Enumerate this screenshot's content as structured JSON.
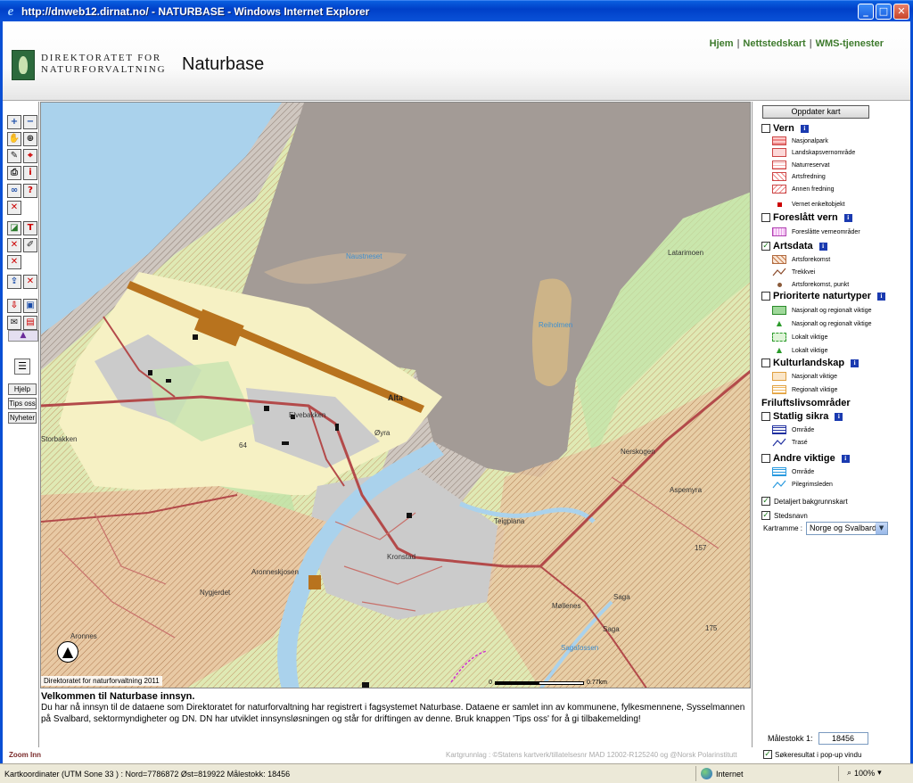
{
  "window": {
    "title": "http://dnweb12.dirnat.no/ - NATURBASE - Windows Internet Explorer",
    "min_label": "_",
    "max_label": "□",
    "close_label": "✕"
  },
  "header": {
    "org_line1": "DIREKTORATET FOR",
    "org_line2": "NATURFORVALTNING",
    "app_title": "Naturbase",
    "links": [
      "Hjem",
      "Nettstedskart",
      "WMS-tjenester"
    ],
    "separator": "|"
  },
  "toolbar": {
    "buttons": [
      {
        "icon": "zoom-in-icon",
        "glyph": "+",
        "tone": "blue"
      },
      {
        "icon": "zoom-out-icon",
        "glyph": "−",
        "tone": "blue"
      },
      {
        "icon": "pan-hand-icon",
        "glyph": "✋",
        "tone": ""
      },
      {
        "icon": "zoom-extent-icon",
        "glyph": "⊕",
        "tone": ""
      },
      {
        "icon": "measure-icon",
        "glyph": "✎",
        "tone": ""
      },
      {
        "icon": "identify-icon",
        "glyph": "⌖",
        "tone": "red"
      },
      {
        "icon": "print-icon",
        "glyph": "⎙",
        "tone": ""
      },
      {
        "icon": "info-icon",
        "glyph": "i",
        "tone": "red"
      },
      {
        "icon": "binoculars-icon",
        "glyph": "∞",
        "tone": "blue"
      },
      {
        "icon": "query-icon",
        "glyph": "?",
        "tone": "red"
      },
      {
        "icon": "clear-select-icon",
        "glyph": "✕",
        "tone": "red"
      },
      {
        "icon": "draw-polygon-icon",
        "glyph": "◪",
        "tone": "green"
      },
      {
        "icon": "select-text-icon",
        "glyph": "T",
        "tone": "red"
      },
      {
        "icon": "delete-icon",
        "glyph": "✕",
        "tone": "red"
      },
      {
        "icon": "edit-pen-icon",
        "glyph": "✐",
        "tone": ""
      },
      {
        "icon": "remove-icon",
        "glyph": "✕",
        "tone": "red"
      },
      {
        "icon": "export-icon",
        "glyph": "⇪",
        "tone": "blue"
      },
      {
        "icon": "remove-layer-icon",
        "glyph": "✕",
        "tone": "red"
      },
      {
        "icon": "import-icon",
        "glyph": "⇩",
        "tone": "red"
      },
      {
        "icon": "save-icon",
        "glyph": "▣",
        "tone": "blue"
      },
      {
        "icon": "mail-icon",
        "glyph": "✉",
        "tone": ""
      },
      {
        "icon": "screen-icon",
        "glyph": "▤",
        "tone": "red"
      }
    ],
    "collapse_glyph": "▲",
    "legend_glyph": "☰",
    "help_buttons": [
      "Hjelp",
      "Tips oss",
      "Nyheter"
    ]
  },
  "map": {
    "place_names": {
      "naustneset": "Naustneset",
      "reiholmen": "Reiholmen",
      "latarimoen": "Latarimoen",
      "alta": "Alta",
      "elvebakken": "Elvebakken",
      "oyra": "Øyra",
      "storbakken": "Storbakken",
      "nerskogen": "Nerskogen",
      "aspemyra": "Aspemyra",
      "teigplana": "Teigplana",
      "kronstad": "Kronstad",
      "aronneskjosen": "Aronneskjosen",
      "nygjerdet": "Nygjerdet",
      "mollenes": "Møllenes",
      "saga1": "Saga",
      "saga2": "Saga",
      "sagafossen": "Sagafossen",
      "aronnes": "Aronnes",
      "elev64": "64",
      "elev157": "157",
      "elev175": "175"
    },
    "copyright": "Direktoratet for naturforvaltning 2011",
    "scale_start": "0",
    "scale_end": "0.77km",
    "north_glyph": "▲"
  },
  "welcome": {
    "title": "Velkommen til Naturbase innsyn.",
    "body": "Du har nå innsyn til de dataene som Direktoratet for naturforvaltning har registrert i fagsystemet Naturbase. Dataene er samlet inn av kommunene, fylkesmennene, Sysselmannen på Svalbard, sektormyndigheter og DN. DN har utviklet innsynsløsningen og står for driftingen av denne. Bruk knappen 'Tips oss' for å gi tilbakemelding!"
  },
  "credits": "Kartgrunnlag : ©Statens kartverk/tillatelsesnr MAD 12002-R125240 og @Norsk Polarinstitutt",
  "zoom_mode": "Zoom Inn",
  "legend": {
    "update_button": "Oppdater kart",
    "info_glyph": "i",
    "check_glyph": "✓",
    "vern": {
      "label": "Vern",
      "items": [
        "Nasjonalpark",
        "Landskapsvernområde",
        "Naturreservat",
        "Artsfredning",
        "Annen fredning",
        "Vernet enkeltobjekt"
      ]
    },
    "foreslatt": {
      "label": "Foreslått vern",
      "items": [
        "Foreslåtte verneområder"
      ]
    },
    "artsdata": {
      "label": "Artsdata",
      "checked": true,
      "items": [
        "Artsforekomst",
        "Trekkvei",
        "Artsforekomst, punkt"
      ]
    },
    "prioriterte": {
      "label": "Prioriterte naturtyper",
      "items": [
        "Nasjonalt og regionalt viktige",
        "Nasjonalt og regionalt viktige",
        "Lokalt viktige",
        "Lokalt viktige"
      ]
    },
    "kulturlandskap": {
      "label": "Kulturlandskap",
      "items": [
        "Nasjonalt viktige",
        "Regionalt viktige"
      ]
    },
    "friluftsliv": {
      "label": "Friluftslivsområder"
    },
    "statlig": {
      "label": "Statlig sikra",
      "items": [
        "Område",
        "Trasé"
      ]
    },
    "andre": {
      "label": "Andre viktige",
      "items": [
        "Område",
        "Pilegrimsleden"
      ]
    },
    "detaljert": "Detaljert bakgrunnskart",
    "stedsnavn": "Stedsnavn",
    "kartramme_label": "Kartramme :",
    "kartramme_value": "Norge og Svalbard",
    "malestokk_label": "Målestokk 1:",
    "malestokk_value": "18456",
    "popup_label": "Søkeresultat i pop-up vindu"
  },
  "status": {
    "coords": "Kartkoordinater (UTM Sone 33 ) :   Nord=7786872  Øst=819922     Målestokk: 18456",
    "zone": "Internet",
    "zoom": "100%"
  }
}
